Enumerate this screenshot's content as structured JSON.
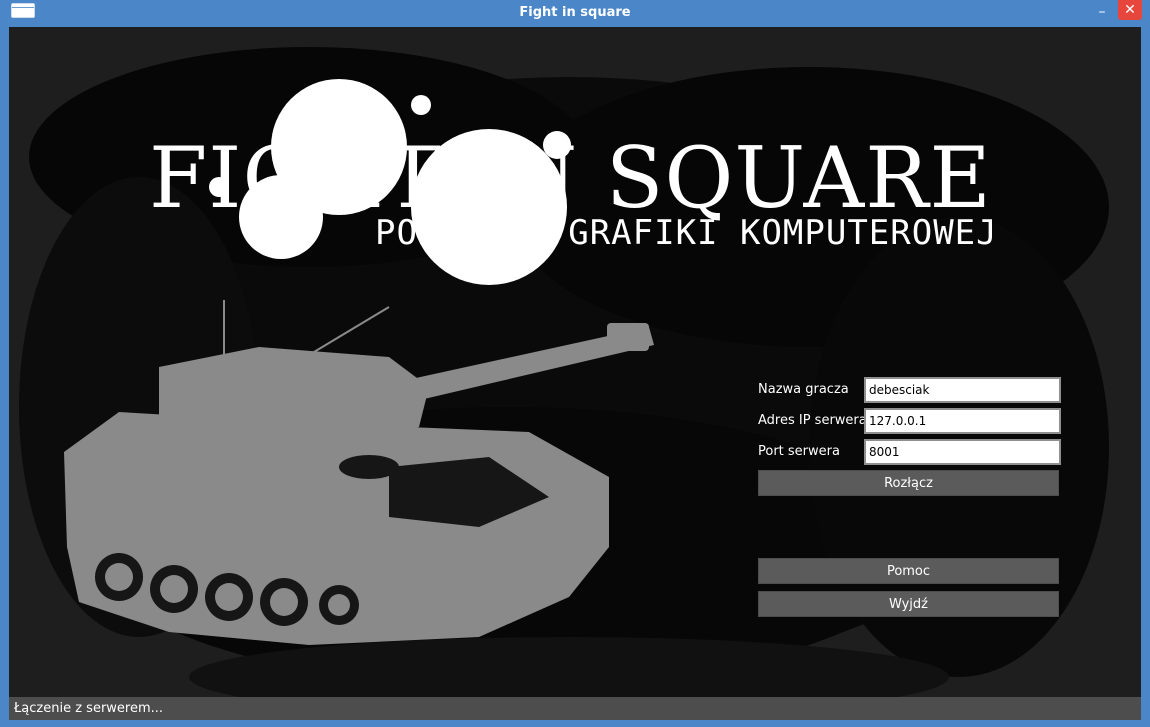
{
  "window": {
    "title": "Fight in square",
    "minimize_glyph": "–",
    "close_glyph": "✕"
  },
  "logo": {
    "title": "FIGHT IN SQUARE",
    "subtitle": "PODSTAWY GRAFIKI KOMPUTEROWEJ"
  },
  "form": {
    "player_name_label": "Nazwa gracza",
    "player_name_value": "debesciak",
    "server_ip_label": "Adres IP serwera",
    "server_ip_value": "127.0.0.1",
    "server_port_label": "Port serwera",
    "server_port_value": "8001",
    "disconnect_label": "Rozłącz"
  },
  "menu": {
    "help_label": "Pomoc",
    "exit_label": "Wyjdź"
  },
  "status": {
    "text": "Łączenie z serwerem..."
  },
  "colors": {
    "titlebar": "#4a86c8",
    "close_button": "#e7463c",
    "button_bg": "#5b5b5b",
    "statusbar": "#4d4d4d",
    "tank": "#8a8a8a"
  },
  "icons": {
    "window_icon": "window-icon",
    "minimize": "minimize-icon",
    "close": "close-icon"
  }
}
